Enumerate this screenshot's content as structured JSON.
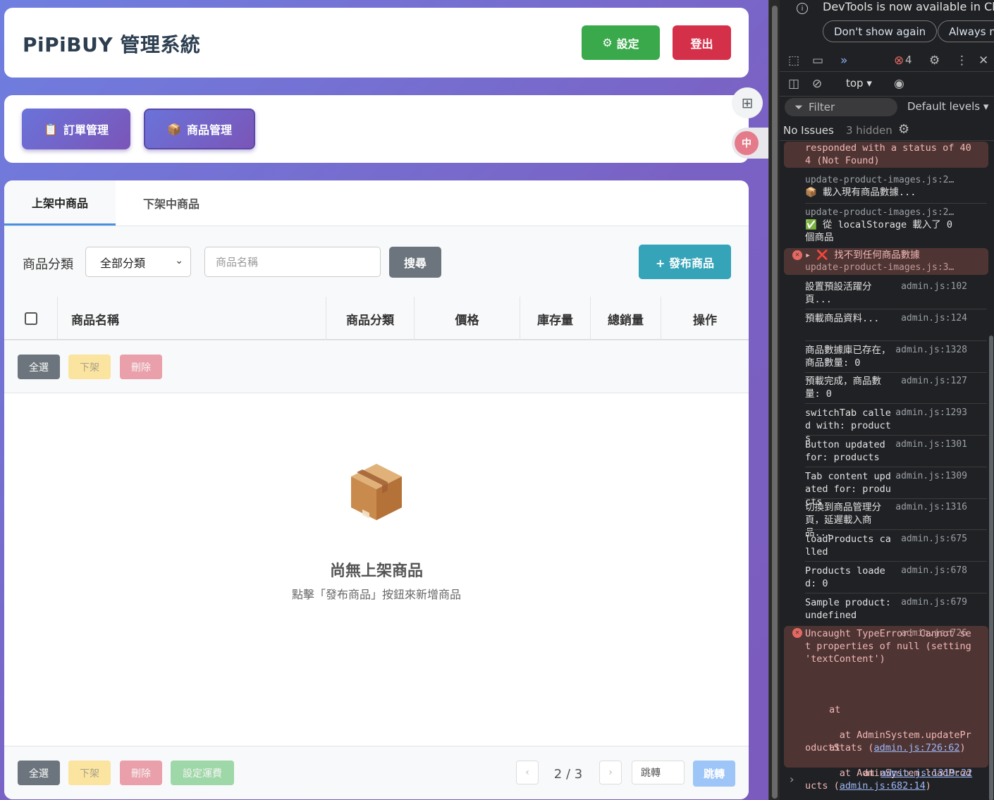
{
  "header": {
    "title": "PiPiBUY 管理系統",
    "settings_label": "設定",
    "settings_icon": "⚙",
    "logout_label": "登出"
  },
  "nav": {
    "orders_label": "訂單管理",
    "orders_icon": "📋",
    "products_label": "商品管理",
    "products_icon": "📦"
  },
  "tabs": {
    "active": "上架中商品",
    "inactive": "下架中商品"
  },
  "filter": {
    "category_label": "商品分類",
    "category_value": "全部分類",
    "search_placeholder": "商品名稱",
    "search_label": "搜尋",
    "publish_label": "+ 發布商品"
  },
  "table": {
    "columns": [
      "商品名稱",
      "商品分類",
      "價格",
      "庫存量",
      "總銷量",
      "操作"
    ]
  },
  "batch": {
    "select_all": "全選",
    "take_down": "下架",
    "delete": "刪除",
    "shipping": "設定運費"
  },
  "empty": {
    "title": "尚無上架商品",
    "hint": "點擊「發布商品」按鈕來新增商品"
  },
  "pagination": {
    "prev": "‹",
    "next": "›",
    "page_info": "2 / 3",
    "jump_placeholder": "跳轉",
    "jump_label": "跳轉"
  },
  "devtools": {
    "notice": "DevTools is now available in Chi",
    "dont_show": "Don't show again",
    "always": "Always m",
    "error_count": "4",
    "context": "top",
    "filter_placeholder": "Filter",
    "levels": "Default levels",
    "no_issues": "No Issues",
    "hidden": "3 hidden",
    "logs": [
      {
        "text": "responded with a status of 404 (Not Found)"
      },
      {
        "src": "update-product-images.js:2…",
        "text": "📦 載入現有商品數據..."
      },
      {
        "src": "update-product-images.js:2…",
        "text": "✅ 從 localStorage 載入了 0 個商品"
      },
      {
        "text": "▸ ❌ 找不到任何商品數據",
        "src": "update-product-images.js:3…"
      },
      {
        "text": "設置預設活躍分頁...",
        "src": "admin.js:102"
      },
      {
        "text": "預載商品資料...",
        "src": "admin.js:124"
      },
      {
        "text": "商品數據庫已存在，商品數量: 0",
        "src": "admin.js:1328"
      },
      {
        "text": "預載完成，商品數量: 0",
        "src": "admin.js:127"
      },
      {
        "text": "switchTab called with: products",
        "src": "admin.js:1293"
      },
      {
        "text": "Button updated for: products",
        "src": "admin.js:1301"
      },
      {
        "text": "Tab content updated for: products",
        "src": "admin.js:1309"
      },
      {
        "text": "切換到商品管理分頁，延遲載入商品...",
        "src": "admin.js:1316"
      },
      {
        "text": "loadProducts called",
        "src": "admin.js:675"
      },
      {
        "text": "Products loaded: 0",
        "src": "admin.js:678"
      },
      {
        "text": "Sample product: undefined",
        "src": "admin.js:679"
      },
      {
        "text": "Uncaught TypeError: Cannot set properties of null (setting 'textContent')",
        "src": "admin.js:726"
      }
    ],
    "stack": {
      "at1": "at AdminSystem.updateProductStats (",
      "link1": "admin.js:726:62",
      "at2": "at AdminSystem.loadProducts (",
      "link2": "admin.js:682:14",
      "at3": "at ",
      "link3": "admin.js:1319:22"
    },
    "prompt": "›"
  }
}
